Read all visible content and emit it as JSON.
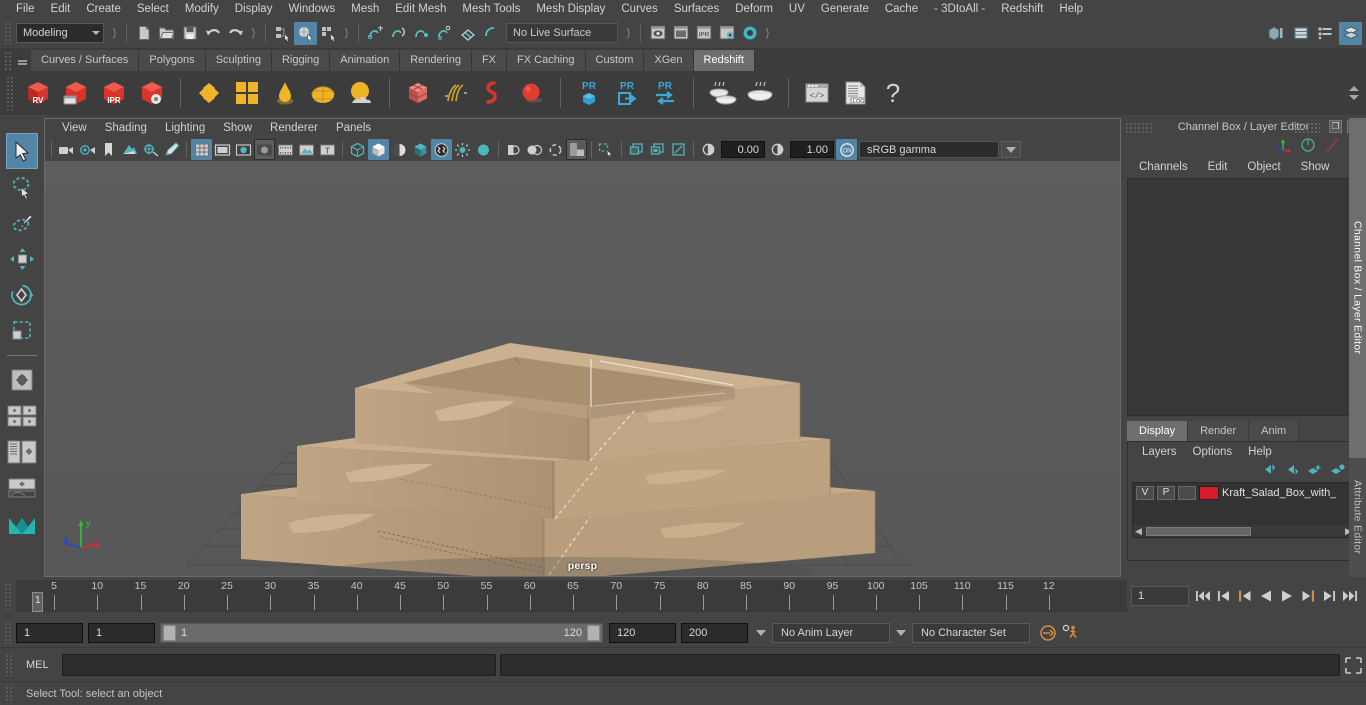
{
  "menubar": {
    "items": [
      "File",
      "Edit",
      "Create",
      "Select",
      "Modify",
      "Display",
      "Windows",
      "Mesh",
      "Edit Mesh",
      "Mesh Tools",
      "Mesh Display",
      "Curves",
      "Surfaces",
      "Deform",
      "UV",
      "Generate",
      "Cache",
      "- 3DtoAll -",
      "Redshift",
      "Help"
    ]
  },
  "statusbar": {
    "menu_set": "Modeling",
    "live_surface": "No Live Surface",
    "icons": [
      "new-scene-icon",
      "open-scene-icon",
      "save-scene-icon",
      "undo-icon",
      "redo-icon",
      "select-by-hierarchy-icon",
      "select-by-object-icon",
      "select-by-component-icon",
      "snap-to-grid-icon",
      "snap-to-curve-icon",
      "snap-to-point-icon",
      "snap-to-projected-center-icon",
      "snap-to-view-plane-icon",
      "make-live-icon",
      "render-view-icon",
      "render-sequence-icon",
      "ipr-render-icon",
      "render-settings-icon",
      "hypershade-icon"
    ],
    "right_icons": [
      "show-hide-modeling-toolkit-icon",
      "show-hide-attribute-editor-icon",
      "show-hide-tool-settings-icon",
      "show-hide-channel-box-icon"
    ]
  },
  "shelf": {
    "tabs": [
      "Curves / Surfaces",
      "Polygons",
      "Sculpting",
      "Rigging",
      "Animation",
      "Rendering",
      "FX",
      "FX Caching",
      "Custom",
      "XGen",
      "Redshift"
    ],
    "selected_tab": "Redshift",
    "icons": [
      "redshift-render-view-icon",
      "redshift-render-sequence-icon",
      "redshift-ipr-icon",
      "redshift-render-settings-icon",
      "redshift-proxy-icon",
      "redshift-matte-icon",
      "redshift-volume-icon",
      "redshift-dome-light-icon",
      "redshift-environment-icon",
      "redshift-object-properties-icon",
      "redshift-hair-icon",
      "redshift-curve-icon",
      "redshift-sphere-light-icon",
      "redshift-pr-bake-icon",
      "redshift-pr-export-icon",
      "redshift-pr-toggle-icon",
      "redshift-bake-set-icon",
      "redshift-bake-all-icon",
      "redshift-script-editor-icon",
      "redshift-log-icon",
      "redshift-help-icon"
    ]
  },
  "toolbox": {
    "items": [
      {
        "name": "select-tool",
        "selected": true
      },
      {
        "name": "lasso-select-tool",
        "selected": false
      },
      {
        "name": "paint-select-tool",
        "selected": false
      },
      {
        "name": "move-tool",
        "selected": false
      },
      {
        "name": "rotate-tool",
        "selected": false
      },
      {
        "name": "scale-tool",
        "selected": false
      },
      {
        "name": "last-tool-used",
        "selected": false
      },
      {
        "name": "single-perspective-layout",
        "selected": false
      },
      {
        "name": "four-view-layout",
        "selected": false
      },
      {
        "name": "outliner-persp-layout",
        "selected": false
      },
      {
        "name": "persp-graph-layout",
        "selected": false
      },
      {
        "name": "maya-logo",
        "selected": false
      }
    ]
  },
  "viewport": {
    "menus": [
      "View",
      "Shading",
      "Lighting",
      "Show",
      "Renderer",
      "Panels"
    ],
    "toolbar_icons": [
      "select-camera-icon",
      "camera-attributes-icon",
      "bookmark-icon",
      "image-plane-icon",
      "two-d-pan-zoom-icon",
      "grease-pencil-icon",
      "grid-icon",
      "film-gate-icon",
      "resolution-gate-icon",
      "gate-mask-icon",
      "film-origin-icon",
      "exposure-icon",
      "safe-title-icon",
      "wireframe-icon",
      "smooth-shade-all-icon",
      "shaded-wireframe-icon",
      "texture-icon",
      "use-all-lights-icon",
      "shadows-icon",
      "ambient-occlusion-icon",
      "motion-blur-icon",
      "multisample-icon",
      "depth-of-field-icon",
      "isolate-select-icon",
      "xray-icon",
      "xray-joints-icon",
      "xray-active-components-icon",
      "exposure-reset-icon",
      "gamma-reset-icon"
    ],
    "exposure_value": "0.00",
    "gamma_value": "1.00",
    "color_management_toggle": "ON",
    "color_space": "sRGB gamma",
    "camera_label": "persp",
    "axis": {
      "x": "x",
      "y": "y",
      "z": "z"
    }
  },
  "right_dock": {
    "panel_title": "Channel Box / Layer Editor",
    "restore_glyph": "❐",
    "close_glyph": "✕",
    "channelbox_menus": [
      "Channels",
      "Edit",
      "Object",
      "Show"
    ],
    "layer_editor_tabs": [
      "Display",
      "Render",
      "Anim"
    ],
    "layer_editor_selected_tab": "Display",
    "layer_menus": [
      "Layers",
      "Options",
      "Help"
    ],
    "layer_buttons": [
      "move-layer-up-icon",
      "move-layer-down-icon",
      "create-new-layer-icon",
      "create-layer-from-selected-icon"
    ],
    "layers": [
      {
        "visibility": "V",
        "playback": "P",
        "shading": "",
        "color": "#d81b2c",
        "name": "Kraft_Salad_Box_with_"
      }
    ],
    "vertical_tabs": [
      {
        "label": "Channel Box / Layer Editor",
        "selected": true
      },
      {
        "label": "Attribute Editor",
        "selected": false
      }
    ]
  },
  "timeline": {
    "labels": [
      "5",
      "10",
      "15",
      "20",
      "25",
      "30",
      "35",
      "40",
      "45",
      "50",
      "55",
      "60",
      "65",
      "70",
      "75",
      "80",
      "85",
      "90",
      "95",
      "100",
      "105",
      "110",
      "115",
      "12"
    ],
    "current_frame_marker": "1",
    "current_frame_field": "1",
    "playback_buttons": [
      {
        "name": "go-to-start-button",
        "accent": false
      },
      {
        "name": "step-back-keyframe-button",
        "accent": false
      },
      {
        "name": "step-back-frame-button",
        "accent": true
      },
      {
        "name": "play-backwards-button",
        "accent": false
      },
      {
        "name": "play-forwards-button",
        "accent": false
      },
      {
        "name": "step-forward-frame-button",
        "accent": true
      },
      {
        "name": "step-forward-keyframe-button",
        "accent": false
      },
      {
        "name": "go-to-end-button",
        "accent": false
      }
    ]
  },
  "range": {
    "anim_start": "1",
    "playback_start": "1",
    "slider_start_label": "1",
    "slider_end_label": "120",
    "playback_end": "120",
    "anim_end": "200",
    "anim_layer": "No Anim Layer",
    "character_set": "No Character Set",
    "auto_key_icon": "auto-keyframe-icon",
    "anim_prefs_icon": "animation-preferences-icon"
  },
  "command_line": {
    "language_label": "MEL",
    "input_value": "",
    "result_value": "",
    "expand_icon": "expand-script-editor-icon"
  },
  "status_line": {
    "message": "Select Tool: select an object"
  },
  "colors": {
    "accent_blue": "#5285a6",
    "accent_teal": "#4ab3bf",
    "accent_orange": "#d98c3f",
    "layer_red": "#d81b2c",
    "shelf_yellow": "#f0b429",
    "shelf_red": "#d9342b",
    "panel_bg": "#444444",
    "viewport_bg": "#5b5b5b",
    "box_kraft": "#c2a882"
  }
}
